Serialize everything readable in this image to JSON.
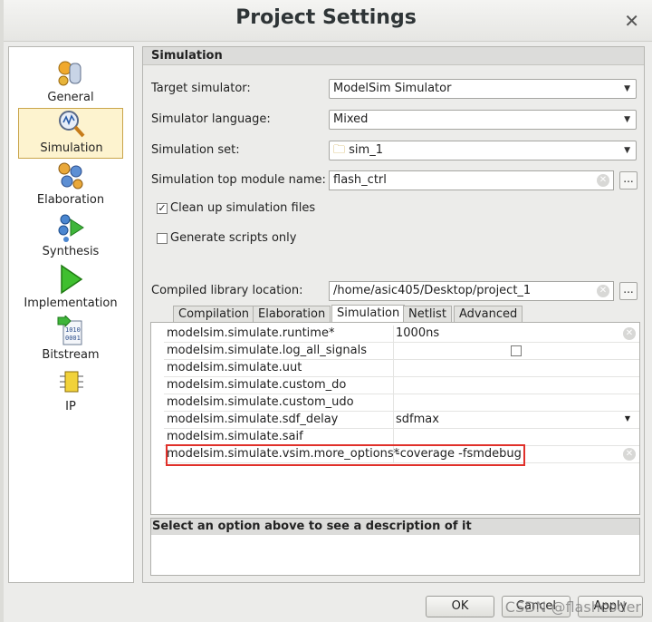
{
  "window": {
    "title": "Project Settings"
  },
  "categories": [
    {
      "label": "General",
      "icon": "general-icon",
      "selected": false
    },
    {
      "label": "Simulation",
      "icon": "simulation-icon",
      "selected": true
    },
    {
      "label": "Elaboration",
      "icon": "elaboration-icon",
      "selected": false
    },
    {
      "label": "Synthesis",
      "icon": "synthesis-icon",
      "selected": false
    },
    {
      "label": "Implementation",
      "icon": "implementation-icon",
      "selected": false
    },
    {
      "label": "Bitstream",
      "icon": "bitstream-icon",
      "selected": false
    },
    {
      "label": "IP",
      "icon": "ip-icon",
      "selected": false
    }
  ],
  "section": {
    "title": "Simulation"
  },
  "form": {
    "target_simulator": {
      "label": "Target simulator:",
      "value": "ModelSim Simulator"
    },
    "simulator_language": {
      "label": "Simulator language:",
      "value": "Mixed"
    },
    "simulation_set": {
      "label": "Simulation set:",
      "value": "sim_1"
    },
    "top_module": {
      "label": "Simulation top module name:",
      "value": "flash_ctrl"
    },
    "clean_up": {
      "label": "Clean up simulation files",
      "checked": true
    },
    "gen_scripts": {
      "label": "Generate scripts only",
      "checked": false
    },
    "compiled_lib": {
      "label": "Compiled library location:",
      "value": "/home/asic405/Desktop/project_1"
    },
    "browse_label": "..."
  },
  "tabs": [
    "Compilation",
    "Elaboration",
    "Simulation",
    "Netlist",
    "Advanced"
  ],
  "active_tab": "Simulation",
  "properties": [
    {
      "key": "modelsim.simulate.runtime*",
      "value": "1000ns"
    },
    {
      "key": "modelsim.simulate.log_all_signals",
      "value": ""
    },
    {
      "key": "modelsim.simulate.uut",
      "value": ""
    },
    {
      "key": "modelsim.simulate.custom_do",
      "value": ""
    },
    {
      "key": "modelsim.simulate.custom_udo",
      "value": ""
    },
    {
      "key": "modelsim.simulate.sdf_delay",
      "value": "sdfmax"
    },
    {
      "key": "modelsim.simulate.saif",
      "value": ""
    },
    {
      "key": "modelsim.simulate.vsim.more_options*",
      "value": "-coverage -fsmdebug"
    }
  ],
  "description": {
    "title": "Select an option above to see a description of it"
  },
  "buttons": {
    "ok": "OK",
    "cancel": "Cancel",
    "apply": "Apply"
  },
  "watermark": "CSDN @flashcoder",
  "colors": {
    "highlight": "#e0302a",
    "selected_bg": "#fdf3cf",
    "selected_border": "#c9a54a"
  }
}
